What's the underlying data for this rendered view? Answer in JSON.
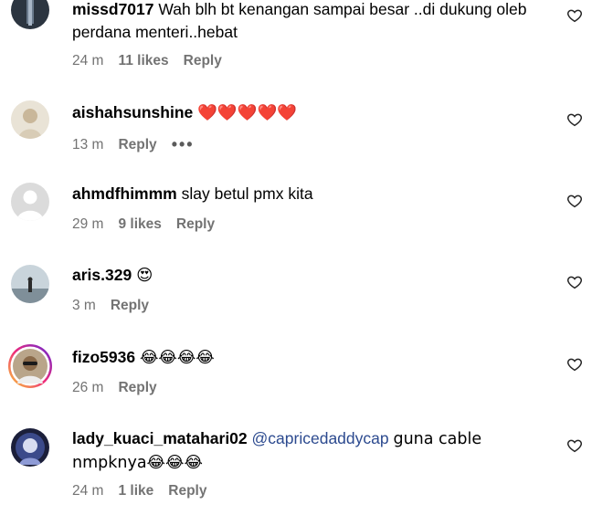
{
  "comments": [
    {
      "username": "missd7017",
      "text": "Wah blh bt kenangan sampai besar ..di dukung oleb perdana menteri..hebat",
      "time": "24 m",
      "likes": "11 likes",
      "reply": "Reply"
    },
    {
      "username": "aishahsunshine",
      "text": "❤️❤️❤️❤️❤️",
      "time": "13 m",
      "reply": "Reply",
      "more": "•••"
    },
    {
      "username": "ahmdfhimmm",
      "text": "slay betul pmx kita",
      "time": "29 m",
      "likes": "9 likes",
      "reply": "Reply"
    },
    {
      "username": "aris.329",
      "text": "😍",
      "time": "3 m",
      "reply": "Reply"
    },
    {
      "username": "fizo5936",
      "text": "😂😂😂😂",
      "time": "26 m",
      "reply": "Reply"
    },
    {
      "username": "lady_kuaci_matahari02",
      "mention": "@capricedaddycap",
      "text": "guna cable nmpknya😂😂😂",
      "time": "24 m",
      "likes": "1 like",
      "reply": "Reply"
    }
  ],
  "icons": {
    "like": "heart-outline-icon"
  }
}
